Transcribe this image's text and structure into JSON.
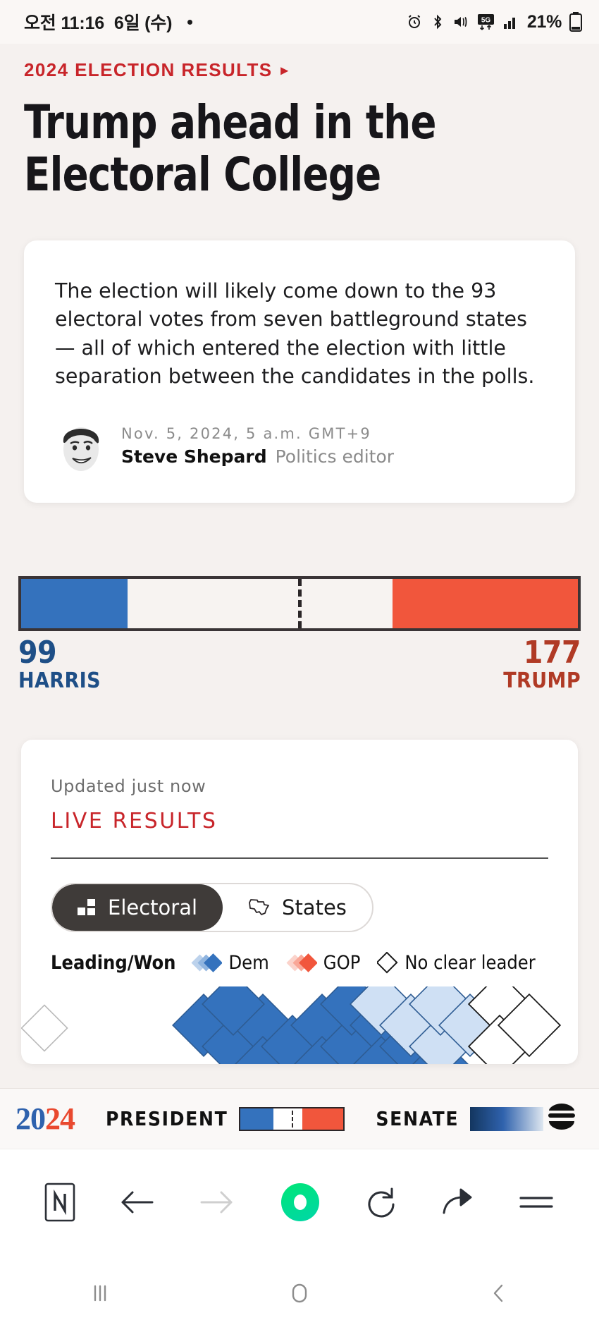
{
  "statusbar": {
    "time": "오전 11:16",
    "date": "6일 (수)",
    "battery": "21%",
    "icons": [
      "alarm-icon",
      "bluetooth-icon",
      "mute-icon",
      "5g-icon",
      "signal-icon",
      "battery-icon"
    ]
  },
  "article": {
    "kicker": "2024 ELECTION RESULTS",
    "kicker_arrow": "▸",
    "headline_line1": "Trump ahead in the",
    "headline_line2": "Electoral College",
    "dek": "The election will likely come down to the 93 electoral votes from seven battleground states — all of which entered the election with little separation between the candidates in the polls.",
    "byline": {
      "date": "Nov. 5, 2024, 5 a.m. GMT+9",
      "name": "Steve Shepard",
      "role": "Politics editor"
    }
  },
  "electoral_bar": {
    "left": {
      "value": "99",
      "name": "HARRIS",
      "color": "#3472bd"
    },
    "right": {
      "value": "177",
      "name": "TRUMP",
      "color": "#f1563c"
    },
    "left_label_color": "#1e4f87",
    "right_label_color": "#b03a25",
    "total": 538,
    "left_pct": 19.1,
    "right_pct": 33.3
  },
  "live_results": {
    "updated": "Updated just now",
    "title": "LIVE RESULTS",
    "toggle": [
      {
        "label": "Electoral",
        "icon": "bar-blocks-icon",
        "active": true
      },
      {
        "label": "States",
        "icon": "texas-map-icon",
        "active": false
      }
    ],
    "legend": {
      "heading": "Leading/Won",
      "items": [
        {
          "label": "Dem",
          "icon": "diamond-pair-blue-icon",
          "color": "#3472bd"
        },
        {
          "label": "GOP",
          "icon": "diamond-pair-red-icon",
          "color": "#f1563c"
        },
        {
          "label": "No clear leader",
          "icon": "diamond-outline-icon",
          "color": "#ffffff"
        }
      ]
    }
  },
  "election_footer": {
    "logo": {
      "first": "20",
      "second": "24"
    },
    "president_label": "PRESIDENT",
    "senate_label": "SENATE",
    "menu_icon": "hamburger-icon"
  },
  "browser_nav": {
    "buttons": [
      {
        "name": "naver-logo-button",
        "icon": "naver-n-icon"
      },
      {
        "name": "back-button",
        "icon": "arrow-left-icon"
      },
      {
        "name": "forward-button",
        "icon": "arrow-right-icon"
      },
      {
        "name": "naver-home-button",
        "icon": "green-circle-icon"
      },
      {
        "name": "reload-button",
        "icon": "refresh-icon"
      },
      {
        "name": "share-button",
        "icon": "share-arrow-icon"
      },
      {
        "name": "menu-button",
        "icon": "hamburger-icon"
      }
    ]
  },
  "android_nav": {
    "buttons": [
      {
        "name": "recents-button",
        "icon": "recents-icon"
      },
      {
        "name": "home-button",
        "icon": "home-squircle-icon"
      },
      {
        "name": "back-button",
        "icon": "chevron-left-icon"
      }
    ]
  },
  "colors": {
    "page_bg": "#f5f1ef",
    "accent_red": "#c8252a",
    "dem_blue": "#3472bd",
    "gop_red": "#f1563c"
  }
}
